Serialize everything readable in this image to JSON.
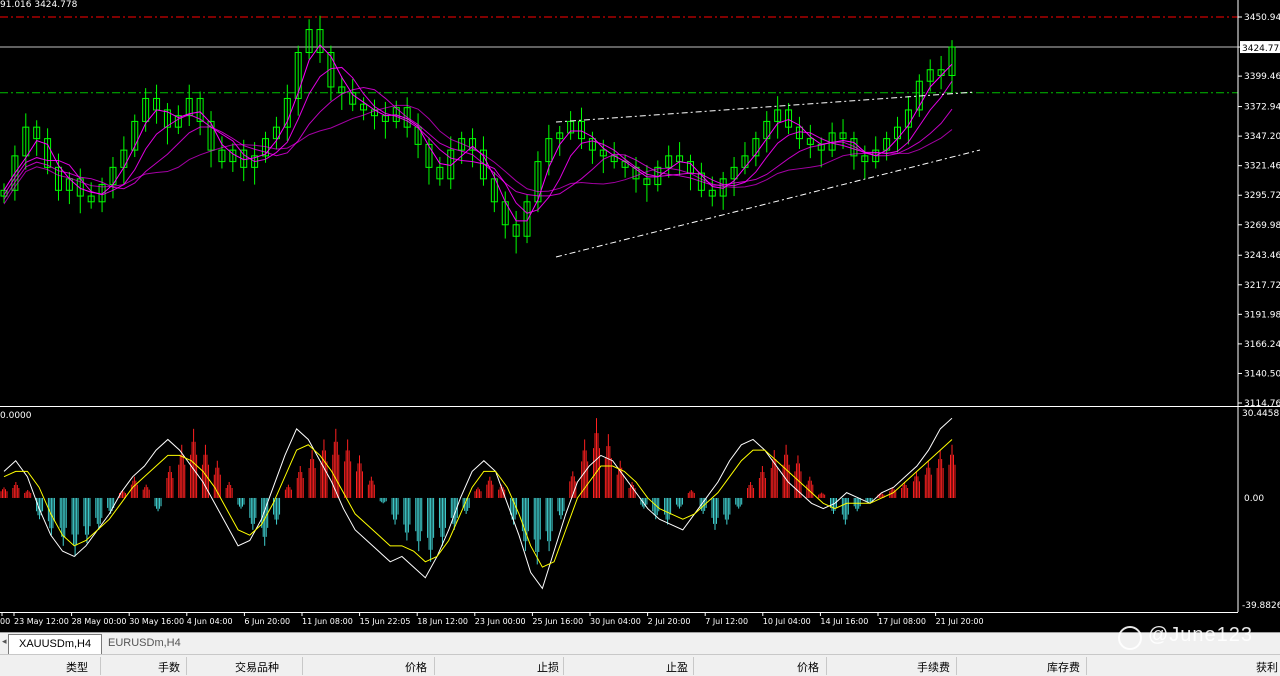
{
  "header": {
    "info": "91.016 3424.778"
  },
  "price_axis": {
    "labels": [
      "3450.940",
      "3424.778",
      "3399.460",
      "3372.940",
      "3347.200",
      "3321.460",
      "3295.720",
      "3269.980",
      "3243.460",
      "3217.720",
      "3191.980",
      "3166.240",
      "3140.500",
      "3114.760"
    ],
    "current": "3424.778"
  },
  "indicator_axis": {
    "top": "30.4458",
    "zero": "0.00",
    "bottom": "-39.8826",
    "left_label": "0.0000"
  },
  "time_axis": [
    "00",
    "23 May 12:00",
    "28 May 00:00",
    "30 May 16:00",
    "4 Jun 04:00",
    "6 Jun 20:00",
    "11 Jun 08:00",
    "15 Jun 22:05",
    "18 Jun 12:00",
    "23 Jun 00:00",
    "25 Jun 16:00",
    "30 Jun 04:00",
    "2 Jul 20:00",
    "7 Jul 12:00",
    "10 Jul 04:00",
    "14 Jul 16:00",
    "17 Jul 08:00",
    "21 Jul 20:00"
  ],
  "tabs": {
    "items": [
      "XAUUSDm,H4",
      "EURUSDm,H4"
    ]
  },
  "table": {
    "columns": [
      "类型",
      "手数",
      "交易品种",
      "价格",
      "止损",
      "止盈",
      "价格",
      "手续费",
      "库存费",
      "获利"
    ]
  },
  "watermark": {
    "text": "@June123"
  },
  "colors": {
    "bull": "#00ff00",
    "bear": "#00ff00",
    "ma": "#ff00ff",
    "hist_pos": "#ff2020",
    "hist_neg": "#40d0d0",
    "signal": "#ffff00",
    "macd": "#ffffff",
    "resistance": "#ff0000",
    "support": "#00c000"
  },
  "chart_data": {
    "type": "candlestick",
    "symbol": "XAUUSDm",
    "timeframe": "H4",
    "ylim": [
      3114.76,
      3450.94
    ],
    "close": [
      3300,
      3330,
      3355,
      3345,
      3320,
      3300,
      3310,
      3295,
      3290,
      3305,
      3320,
      3335,
      3360,
      3380,
      3370,
      3355,
      3365,
      3380,
      3360,
      3335,
      3325,
      3335,
      3320,
      3330,
      3345,
      3355,
      3380,
      3420,
      3440,
      3420,
      3390,
      3385,
      3375,
      3370,
      3365,
      3360,
      3372,
      3355,
      3340,
      3320,
      3310,
      3335,
      3345,
      3335,
      3310,
      3290,
      3270,
      3260,
      3290,
      3325,
      3345,
      3350,
      3360,
      3345,
      3335,
      3330,
      3325,
      3320,
      3310,
      3305,
      3320,
      3330,
      3325,
      3315,
      3300,
      3295,
      3310,
      3320,
      3330,
      3345,
      3360,
      3370,
      3355,
      3345,
      3340,
      3335,
      3350,
      3345,
      3330,
      3325,
      3335,
      3345,
      3355,
      3370,
      3395,
      3405,
      3400,
      3424.778
    ],
    "annotations": [
      "resistance 3450.940",
      "support 3385.000",
      "ascending channel"
    ],
    "indicator": {
      "type": "macd",
      "ylim": [
        -39.8826,
        30.4458
      ],
      "hist": [
        4,
        6,
        3,
        -8,
        -14,
        -18,
        -22,
        -17,
        -12,
        -6,
        3,
        8,
        5,
        -5,
        12,
        20,
        26,
        20,
        14,
        6,
        -4,
        -12,
        -18,
        -10,
        5,
        12,
        18,
        22,
        26,
        22,
        16,
        8,
        -2,
        -10,
        -16,
        -20,
        -24,
        -18,
        -12,
        -6,
        4,
        8,
        5,
        -10,
        -20,
        -25,
        -20,
        -8,
        10,
        22,
        30,
        24,
        14,
        6,
        -4,
        -8,
        -10,
        -4,
        3,
        -6,
        -12,
        -10,
        -4,
        6,
        12,
        18,
        20,
        16,
        8,
        2,
        -6,
        -10,
        -5,
        -2,
        2,
        4,
        6,
        10,
        14,
        18,
        20
      ],
      "macd": [
        10,
        14,
        8,
        -4,
        -14,
        -20,
        -22,
        -18,
        -12,
        -6,
        2,
        8,
        12,
        18,
        22,
        18,
        12,
        6,
        -2,
        -10,
        -18,
        -16,
        -8,
        4,
        16,
        26,
        22,
        14,
        6,
        -4,
        -12,
        -16,
        -20,
        -24,
        -22,
        -26,
        -30,
        -22,
        -12,
        0,
        10,
        14,
        10,
        -2,
        -14,
        -28,
        -34,
        -20,
        -6,
        6,
        12,
        16,
        14,
        8,
        2,
        -4,
        -8,
        -10,
        -12,
        -6,
        0,
        6,
        14,
        20,
        22,
        18,
        12,
        6,
        2,
        -2,
        -4,
        -2,
        2,
        0,
        -2,
        2,
        4,
        8,
        12,
        18,
        26,
        30
      ],
      "signal": [
        8,
        10,
        10,
        4,
        -6,
        -14,
        -18,
        -16,
        -12,
        -8,
        -2,
        4,
        8,
        12,
        16,
        16,
        14,
        10,
        4,
        -4,
        -12,
        -14,
        -10,
        -2,
        8,
        18,
        20,
        16,
        10,
        2,
        -6,
        -10,
        -14,
        -18,
        -18,
        -20,
        -24,
        -22,
        -16,
        -6,
        4,
        10,
        10,
        4,
        -6,
        -18,
        -26,
        -24,
        -12,
        0,
        6,
        12,
        12,
        10,
        6,
        0,
        -4,
        -6,
        -8,
        -6,
        -2,
        2,
        8,
        14,
        18,
        18,
        14,
        10,
        6,
        2,
        -2,
        -4,
        -2,
        -2,
        -2,
        0,
        2,
        6,
        10,
        14,
        18,
        22
      ]
    }
  }
}
